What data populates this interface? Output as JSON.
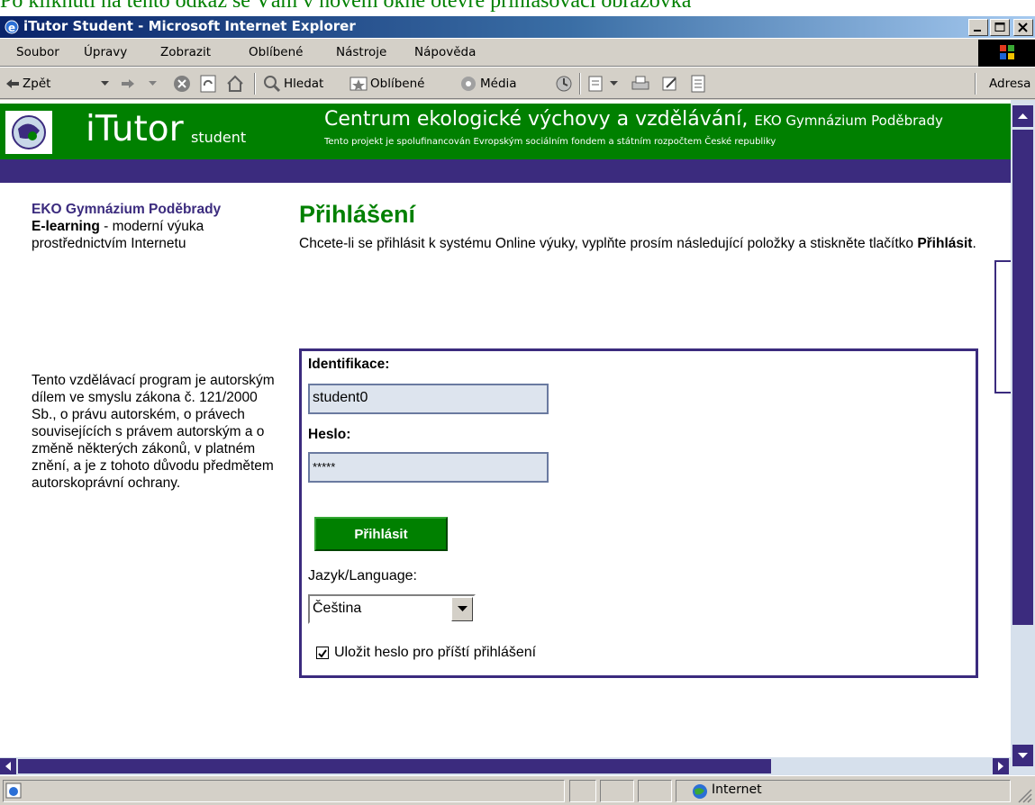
{
  "caption": "Po kliknutí na tento odkaz se Vám v novém okně otevře přihlašovací obrazovka",
  "window": {
    "title": "iTutor Student - Microsoft Internet Explorer"
  },
  "menu": [
    "Soubor",
    "Úpravy",
    "Zobrazit",
    "Oblíbené",
    "Nástroje",
    "Nápověda"
  ],
  "toolbar": {
    "back": "Zpět",
    "search": "Hledat",
    "favorites": "Oblíbené",
    "media": "Média",
    "address": "Adresa"
  },
  "banner": {
    "brand": "iTutor",
    "brand_sub": "student",
    "title": "Centrum ekologické výchovy a vzdělávání,",
    "title_small": "EKO Gymnázium Poděbrady",
    "note": "Tento projekt je spolufinancován Evropským sociálním fondem a státním rozpočtem České republiky"
  },
  "sidebar": {
    "org": "EKO Gymnázium Poděbrady",
    "tagline_bold": "E-learning",
    "tagline_rest": " - moderní výuka prostřednictvím Internetu",
    "copyright": "Tento vzdělávací program je autorským dílem ve smyslu zákona č. 121/2000 Sb., o právu autorském, o právech souvisejících s právem autorským a o změně některých zákonů, v platném znění, a je z tohoto důvodu předmětem autorskoprávní ochrany."
  },
  "login": {
    "title": "Přihlášení",
    "intro_text": "Chcete-li se přihlásit k systému Online výuky, vyplňte prosím následující položky a stiskněte tlačítko ",
    "intro_bold": "Přihlásit",
    "intro_end": ".",
    "id_label": "Identifikace:",
    "id_value": "student0",
    "password_label": "Heslo:",
    "password_value": "*****",
    "button": "Přihlásit",
    "language_label": "Jazyk/Language:",
    "language_value": "Čeština",
    "remember_label": "Uložit heslo pro příští přihlášení",
    "remember_checked": true
  },
  "status": {
    "zone": "Internet"
  },
  "colors": {
    "brand_green": "#008000",
    "brand_purple": "#3b2b7e",
    "window_gray": "#d4d0c8",
    "field_bg": "#dde4ee"
  }
}
